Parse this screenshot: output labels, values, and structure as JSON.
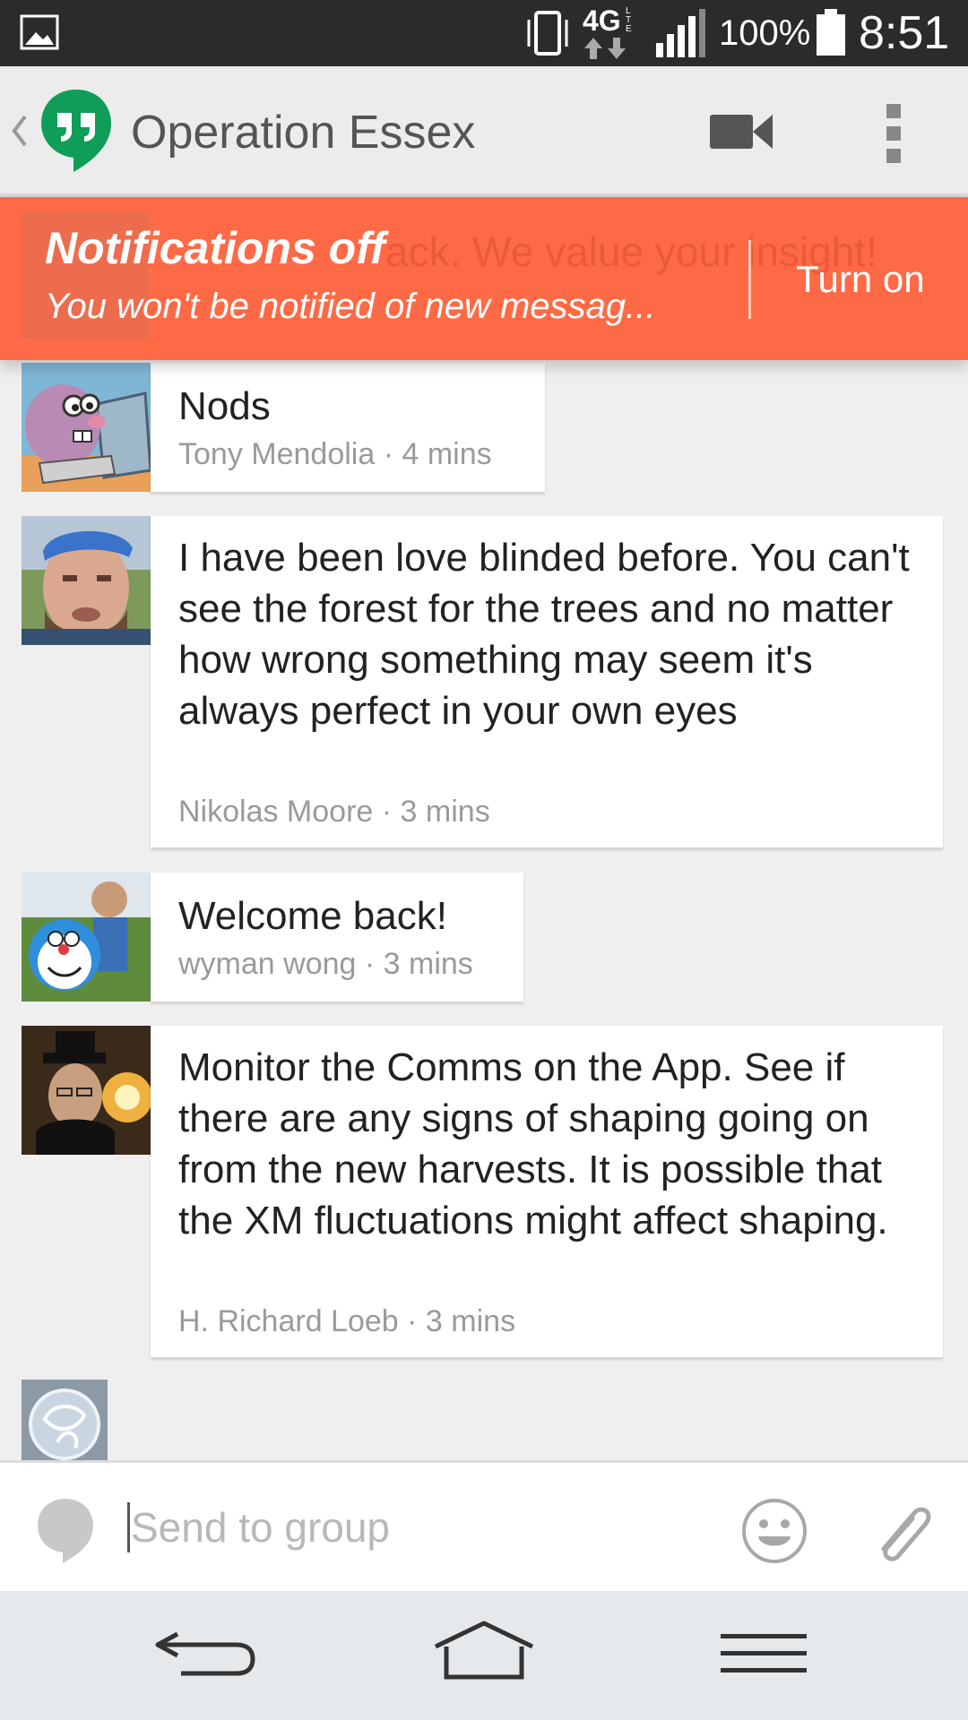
{
  "status_bar": {
    "network": "4G",
    "network_sub": "LTE",
    "battery": "100%",
    "time": "8:51"
  },
  "app_bar": {
    "title": "Operation Essex"
  },
  "banner": {
    "title": "Notifications off",
    "subtitle": "You won't be notified of new messag...",
    "background_text": "ack. We value your insight!",
    "action": "Turn on",
    "color": "#ff6a46"
  },
  "messages": [
    {
      "text": "Nods",
      "author": "Tony Mendolia",
      "time": "4 mins"
    },
    {
      "text": "I have been love blinded before. You can't see the forest for the trees and no matter how wrong something may seem it's always perfect in your own eyes",
      "author": "Nikolas Moore",
      "time": "3 mins"
    },
    {
      "text": "Welcome back!",
      "author": "wyman wong",
      "time": "3 mins"
    },
    {
      "text": "Monitor the Comms on the App. See if there are any signs of shaping going on from the new harvests.  It is possible that the XM fluctuations might affect shaping.",
      "author": "H. Richard Loeb",
      "time": "3 mins"
    }
  ],
  "meta_separator": "·",
  "compose": {
    "placeholder": "Send to group",
    "value": ""
  },
  "icons": {
    "gallery": "gallery-icon",
    "vibrate": "vibrate-icon",
    "signal": "signal-icon",
    "battery": "battery-icon",
    "back": "back-chevron-icon",
    "logo": "hangouts-logo-icon",
    "video": "video-call-icon",
    "overflow": "overflow-menu-icon",
    "chat": "chat-bubble-icon",
    "emoji": "emoji-icon",
    "attach": "attach-icon",
    "nav_back": "nav-back-icon",
    "nav_home": "nav-home-icon",
    "nav_menu": "nav-menu-icon"
  },
  "colors": {
    "hangouts_green": "#0f9d58",
    "banner": "#ff6a46",
    "meta_text": "#9a9a9a"
  }
}
